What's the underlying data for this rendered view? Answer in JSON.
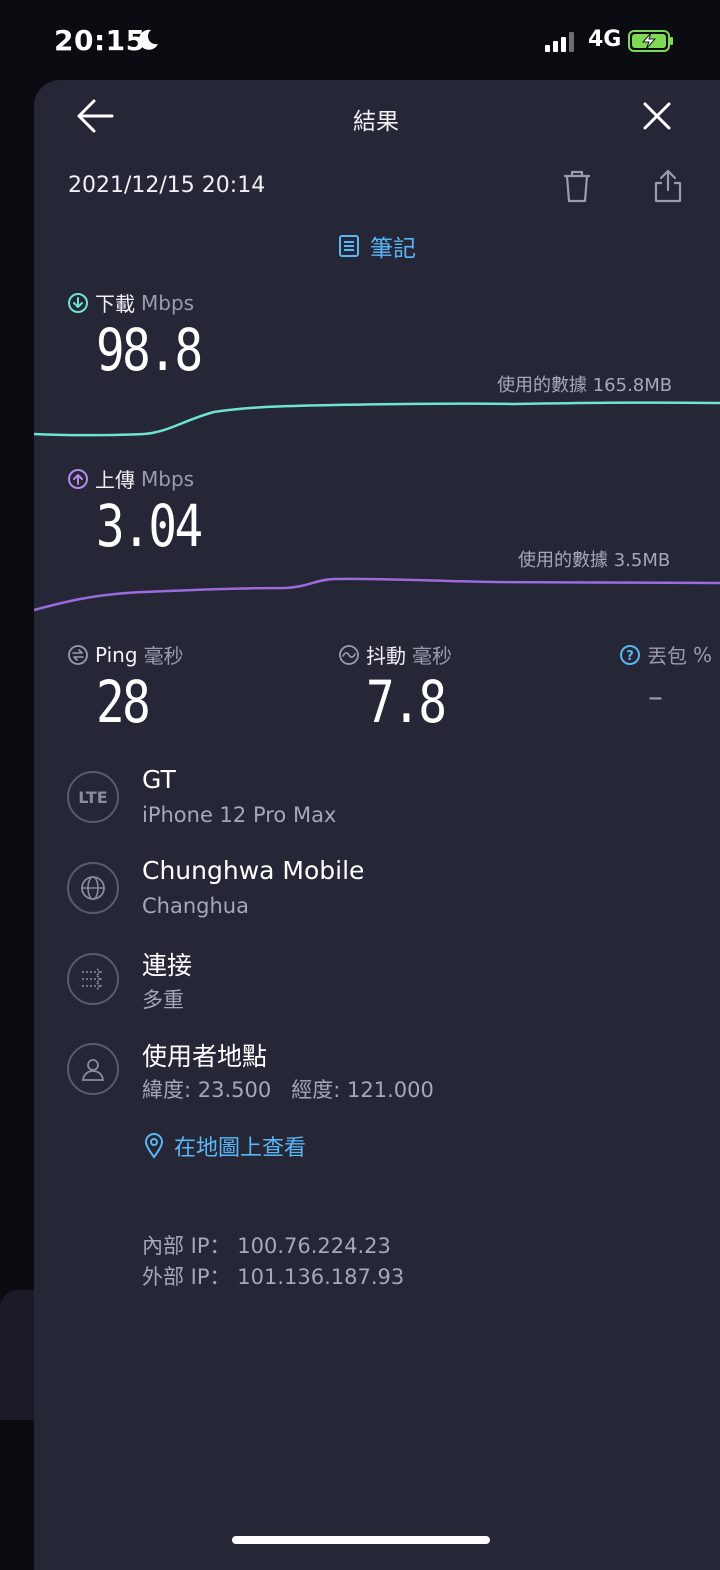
{
  "status": {
    "time": "20:15",
    "network": "4G"
  },
  "header": {
    "title": "結果",
    "date": "2021/12/15 20:14",
    "notes_label": "筆記"
  },
  "download": {
    "label": "下載",
    "unit": "Mbps",
    "value": "98.8",
    "usage": "使用的數據 165.8MB",
    "color": "#6fe3d1"
  },
  "upload": {
    "label": "上傳",
    "unit": "Mbps",
    "value": "3.04",
    "usage": "使用的數據 3.5MB",
    "color": "#9b6bdf"
  },
  "ping": {
    "label": "Ping",
    "unit": "毫秒",
    "value": "28"
  },
  "jitter": {
    "label": "抖動",
    "unit": "毫秒",
    "value": "7.8"
  },
  "loss": {
    "label": "丟包",
    "unit": "%",
    "value": "–"
  },
  "device": {
    "badge": "LTE",
    "title": "GT",
    "subtitle": "iPhone 12 Pro Max"
  },
  "provider": {
    "title": "Chunghwa Mobile",
    "subtitle": "Changhua"
  },
  "connection": {
    "title": "連接",
    "subtitle": "多重"
  },
  "location": {
    "title": "使用者地點",
    "lat_label": "緯度:",
    "lat": "23.500",
    "lon_label": "經度:",
    "lon": "121.000",
    "map_link": "在地圖上查看"
  },
  "ip": {
    "internal_label": "內部 IP：",
    "internal": "100.76.224.23",
    "external_label": "外部 IP：",
    "external": "101.136.187.93"
  },
  "colors": {
    "accent": "#5ab6f5",
    "card": "#252636"
  }
}
